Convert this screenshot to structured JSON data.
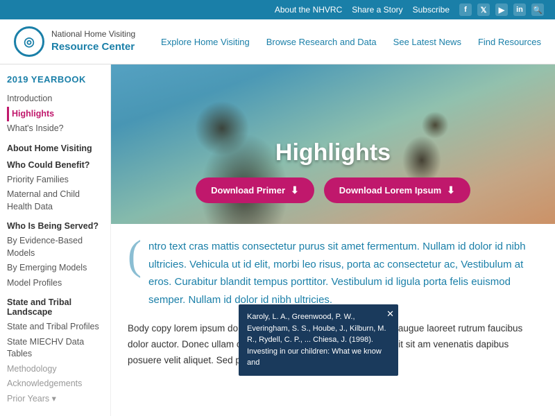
{
  "topbar": {
    "links": [
      "About the NHVRC",
      "Share a Story",
      "Subscribe"
    ],
    "social": [
      "f",
      "t",
      "▶",
      "in",
      "🔍"
    ]
  },
  "header": {
    "logo_line1": "National Home Visiting",
    "logo_title": "Resource Center",
    "nav": [
      "Explore Home Visiting",
      "Browse Research and Data",
      "See Latest News",
      "Find Resources"
    ]
  },
  "sidebar": {
    "year": "2019 YEARBOOK",
    "items": [
      {
        "label": "Introduction",
        "type": "link"
      },
      {
        "label": "Highlights",
        "type": "link",
        "active": true
      },
      {
        "label": "What's Inside?",
        "type": "link"
      },
      {
        "section": "About Home Visiting"
      },
      {
        "section": "Who Could Benefit?",
        "bold": true
      },
      {
        "label": "Priority Families",
        "type": "link"
      },
      {
        "label": "Maternal and Child Health Data",
        "type": "link"
      },
      {
        "section": "Who Is Being Served?",
        "bold": true
      },
      {
        "label": "By Evidence-Based Models",
        "type": "link"
      },
      {
        "label": "By Emerging Models",
        "type": "link"
      },
      {
        "label": "Model Profiles",
        "type": "link"
      },
      {
        "section": "State and Tribal Landscape",
        "bold": true
      },
      {
        "label": "State and Tribal Profiles",
        "type": "link"
      },
      {
        "label": "State MIECHV Data Tables",
        "type": "link"
      },
      {
        "label": "Methodology",
        "type": "link",
        "dim": true
      },
      {
        "label": "Acknowledgements",
        "type": "link",
        "dim": true
      },
      {
        "label": "Prior Years ▾",
        "type": "link",
        "dim": true
      }
    ]
  },
  "hero": {
    "title": "Highlights",
    "btn1": "Download Primer",
    "btn2": "Download Lorem Ipsum"
  },
  "body": {
    "intro": "ntro text cras mattis consectetur purus sit amet fermentum. Nullam id dolor id nibh ultricies. Vehicula ut id elit, morbi leo risus, porta ac consectetur ac, Vestibulum at eros. Curabitur blandit tempus porttitor. Vestibulum id ligula porta felis euismod semper. Nullam id dolor id nibh ultricies.",
    "para1": "Body copy lorem ipsum dolor sit amet. Vivamus sagittis lacus vel augue laoreet rutrum faucibus dolor auctor. Donec ullam cenas sed diam eget risus varius blandit sit am venenatis dapibus posuere velit aliquet. Sed p",
    "citation": "Karoly, L. A., Greenwood, P. W., Everingham, S. S., Hoube, J., Kilburn, M. R., Rydell, C. P., ... Chiesa, J. (1998). Investing in our children: What we know and"
  }
}
